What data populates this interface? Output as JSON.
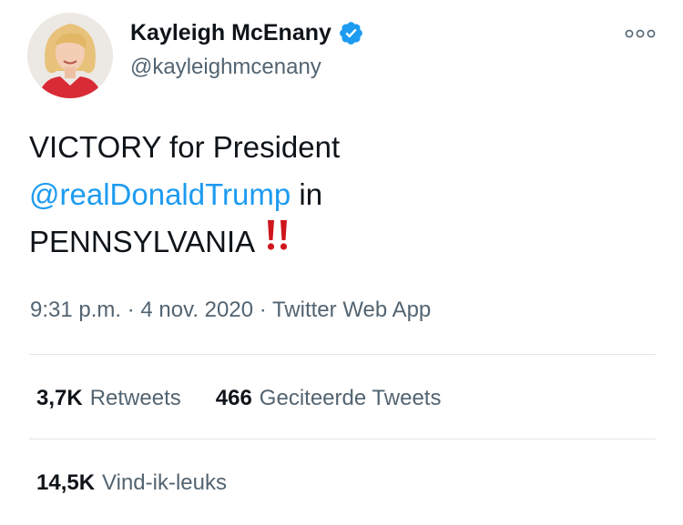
{
  "author": {
    "display_name": "Kayleigh McEnany",
    "handle": "@kayleighmcenany",
    "verified_icon": "verified-badge-icon",
    "avatar_icon": "profile-photo"
  },
  "more_icon": "more-options-icon",
  "tweet": {
    "line1": "VICTORY for President",
    "mention": "@realDonaldTrump",
    "after_mention": "in",
    "line3": "PENNSYLVANIA",
    "emoji_icon": "double-exclamation-icon"
  },
  "meta": {
    "time": "9:31 p.m.",
    "sep1": "·",
    "date": "4 nov. 2020",
    "sep2": "·",
    "source": "Twitter Web App"
  },
  "stats": {
    "retweets_count": "3,7K",
    "retweets_label": "Retweets",
    "quotes_count": "466",
    "quotes_label": "Geciteerde Tweets",
    "likes_count": "14,5K",
    "likes_label": "Vind-ik-leuks"
  },
  "colors": {
    "link": "#1d9bf0",
    "secondary_text": "#536471",
    "primary_text": "#0f1419",
    "emoji_red": "#d0161d"
  }
}
